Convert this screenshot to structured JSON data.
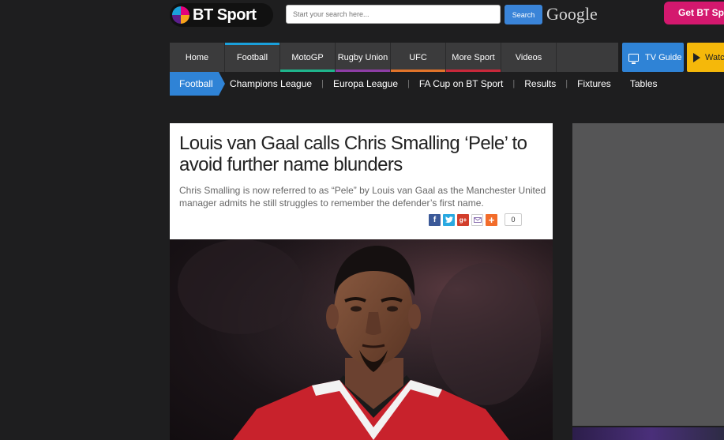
{
  "header": {
    "logo_text": "BT Sport",
    "search_placeholder": "Start your search here...",
    "search_button": "Search",
    "google_label": "Google",
    "get_bt_label": "Get BT Sp"
  },
  "main_nav": {
    "items": [
      {
        "label": "Home"
      },
      {
        "label": "Football"
      },
      {
        "label": "MotoGP"
      },
      {
        "label": "Rugby Union"
      },
      {
        "label": "UFC"
      },
      {
        "label": "More Sport"
      },
      {
        "label": "Videos"
      }
    ],
    "tv_guide": "TV Guide",
    "watch": "Watch"
  },
  "sub_nav": {
    "active": "Football",
    "items": [
      {
        "label": "Champions League"
      },
      {
        "label": "Europa League"
      },
      {
        "label": "FA Cup on BT Sport"
      },
      {
        "label": "Results"
      },
      {
        "label": "Fixtures"
      },
      {
        "label": "Tables"
      }
    ]
  },
  "article": {
    "headline": "Louis van Gaal calls Chris Smalling ‘Pele’ to avoid further name blunders",
    "standfirst": "Chris Smalling is now referred to as “Pele” by Louis van Gaal as the Manchester United manager admits he still struggles to remember the defender’s first name.",
    "share_count": "0"
  },
  "colors": {
    "page_bg": "#1e1e1f",
    "accent_blue": "#2f83d6",
    "watch_yellow": "#f5b80a",
    "get_bt_pink": "#d4186e",
    "nav_bg": "#3b3b3c",
    "motogp_bar": "#1fb58c",
    "rugby_bar": "#8e3da6",
    "ufc_bar": "#e2742a",
    "more_sport_bar": "#c9283a",
    "football_bar": "#1aa0db"
  },
  "icons": [
    "facebook-icon",
    "twitter-icon",
    "google-plus-icon",
    "email-icon",
    "addthis-plus-icon",
    "tv-icon",
    "play-icon"
  ]
}
